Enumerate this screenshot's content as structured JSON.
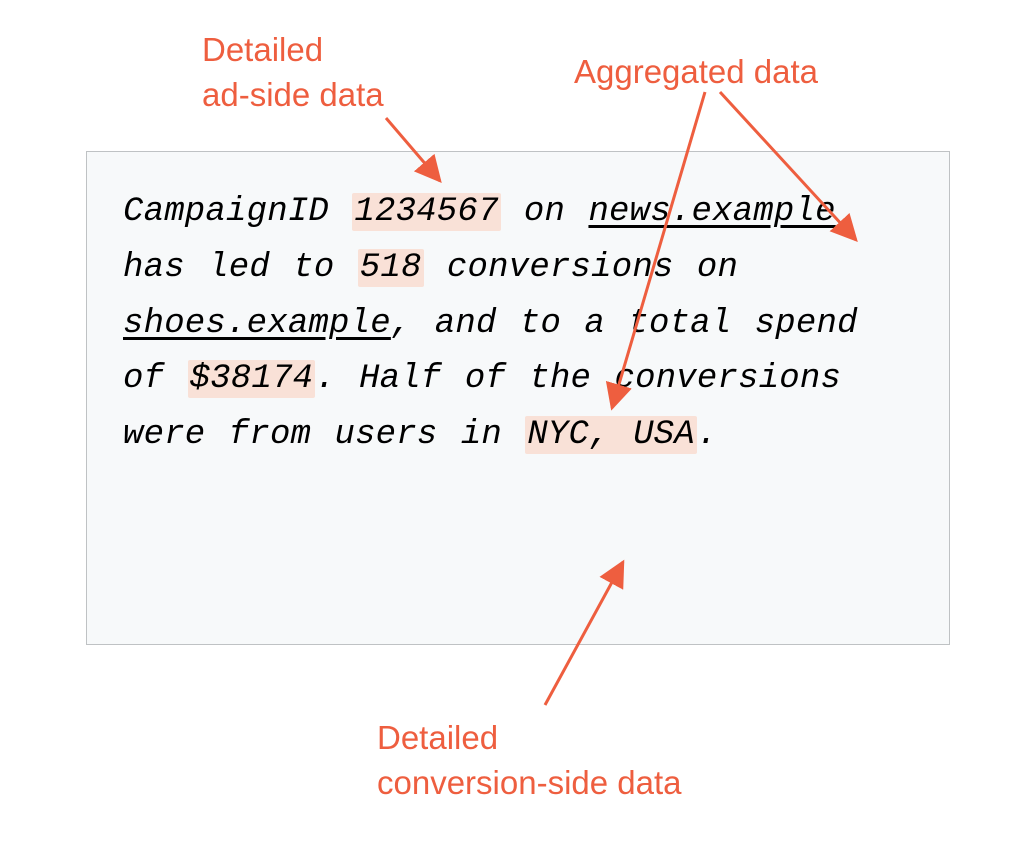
{
  "labels": {
    "adSideLine1": "Detailed",
    "adSideLine2": "ad-side data",
    "aggregated": "Aggregated data",
    "convLine1": "Detailed",
    "convLine2": "conversion-side data"
  },
  "sentence": {
    "t1": "CampaignID ",
    "campaignId": "1234567",
    "t2": " on ",
    "publisher": "news.example",
    "t3": " has led to ",
    "conversions": "518",
    "t4": " conversions on ",
    "advertiser": "shoes.example",
    "t5": ", and to a total spend of ",
    "spend": "$38174",
    "t6": ". Half of the conversions were from users in ",
    "geo": "NYC, USA",
    "t7": "."
  },
  "colors": {
    "accent": "#ee5e3f",
    "highlight": "#f9e1d7",
    "boxBg": "#f7f9fa"
  }
}
